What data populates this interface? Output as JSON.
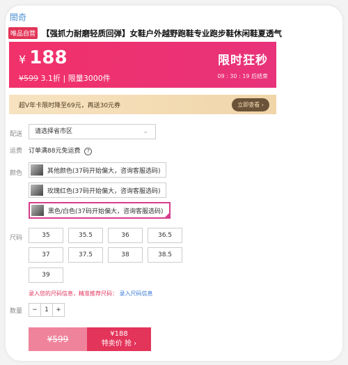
{
  "brand": "閤奇",
  "title": {
    "badge": "唯品自营",
    "text": "【强抓力耐磨轻质回弹】女鞋户外越野跑鞋专业跑步鞋休闲鞋夏透气"
  },
  "price": {
    "currency": "¥",
    "value": "188",
    "original": "¥599",
    "discount": "3.1折",
    "limit": "| 限量3000件",
    "flash_label": "限时狂秒",
    "countdown": "09 : 30 : 19",
    "countdown_suffix": "后结束"
  },
  "vip": {
    "text": "超V年卡限时降至69元，再送30元券",
    "button": "立即查看 ›"
  },
  "delivery": {
    "label": "配送",
    "placeholder": "请选择省市区"
  },
  "shipping": {
    "label": "运费",
    "text": "订单满88元免运费"
  },
  "colors": {
    "label": "颜色",
    "options": [
      "其他颜色(37码开始偏大，咨询客服选码)",
      "玫瑰红色(37码开始偏大，咨询客服选码)",
      "黑色/白色(37码开始偏大，咨询客服选码)"
    ]
  },
  "sizes": {
    "label": "尺码",
    "options": [
      "35",
      "35.5",
      "36",
      "36.5",
      "37",
      "37.5",
      "38",
      "38.5",
      "39"
    ]
  },
  "size_tip": {
    "text": "录入您的尺码信息，精准推荐尺码：",
    "link": "录入尺码信息"
  },
  "quantity": {
    "label": "数量",
    "value": "1",
    "minus": "−",
    "plus": "+"
  },
  "cta": {
    "original": "¥599",
    "price": "¥188",
    "action": "特卖价 抢 ›"
  }
}
